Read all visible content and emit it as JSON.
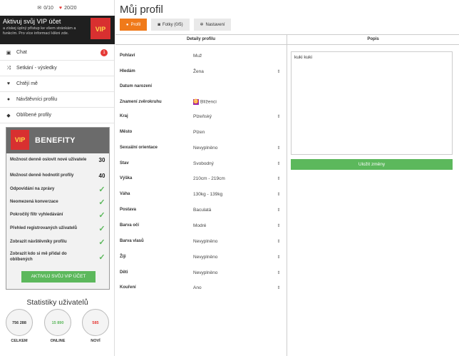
{
  "counters": {
    "messages": "0/10",
    "likes": "20/20"
  },
  "vip_banner": {
    "title": "Aktivuj svůj VIP účet",
    "subtitle": "a získej úplný přístup ke všem stránkám a funkcím. Pro více informací klikni zde.",
    "logo": "VIP"
  },
  "menu": [
    {
      "label": "Chat",
      "icon": "chat-icon",
      "glyph": "▣",
      "badge": "1"
    },
    {
      "label": "Setkání - výsledky",
      "icon": "shuffle-icon",
      "glyph": "⤨"
    },
    {
      "label": "Chtějí mě",
      "icon": "heart-icon",
      "glyph": "♥"
    },
    {
      "label": "Návštěvníci profilu",
      "icon": "user-icon",
      "glyph": "●"
    },
    {
      "label": "Oblíbené profily",
      "icon": "thumbs-up-icon",
      "glyph": "◆"
    }
  ],
  "benefits": {
    "logo": "VIP",
    "title": "BENEFITY",
    "rows": [
      {
        "label": "Možnost denně oslovit nové uživatele",
        "value": "30"
      },
      {
        "label": "Možnost denně hodnotit profily",
        "value": "40"
      },
      {
        "label": "Odpovídání na zprávy",
        "check": true
      },
      {
        "label": "Neomezená konverzace",
        "check": true
      },
      {
        "label": "Pokročilý filtr vyhledávání",
        "check": true
      },
      {
        "label": "Přehled registrovaných uživatelů",
        "check": true
      },
      {
        "label": "Zobrazit návštěvníky profilu",
        "check": true
      },
      {
        "label": "Zobrazit kdo si mě přidal do oblíbených",
        "check": true
      }
    ],
    "button": "AKTIVUJ SVŮJ VIP ÚČET"
  },
  "stats": {
    "title": "Statistiky uživatelů",
    "items": [
      {
        "value": "756 288",
        "label": "CELKEM",
        "color": "#333333"
      },
      {
        "value": "15 890",
        "label": "ONLINE",
        "color": "#5cb85c"
      },
      {
        "value": "585",
        "label": "NOVÍ",
        "color": "#e53935"
      }
    ]
  },
  "page_title": "Můj profil",
  "tabs": [
    {
      "label": "Profil",
      "icon": "user-icon",
      "active": true
    },
    {
      "label": "Fotky (0/5)",
      "icon": "camera-icon",
      "active": false
    },
    {
      "label": "Nastavení",
      "icon": "gear-icon",
      "active": false
    }
  ],
  "details": {
    "title": "Detaily profilu",
    "fields": [
      {
        "label": "Pohlaví",
        "value": "Muž"
      },
      {
        "label": "Hledám",
        "value": "Žena",
        "select": true
      },
      {
        "label": "Datum narození",
        "value": ""
      },
      {
        "label": "Znamení zvěrokruhu",
        "value": "Blíženci",
        "zodiac": "♊"
      },
      {
        "label": "Kraj",
        "value": "Plzeňský",
        "select": true
      },
      {
        "label": "Město",
        "value": "Plzen"
      },
      {
        "label": "Sexuální orientace",
        "value": "Nevyplněno",
        "select": true
      },
      {
        "label": "Stav",
        "value": "Svobodný",
        "select": true
      },
      {
        "label": "Výška",
        "value": "210cm - 219cm",
        "select": true
      },
      {
        "label": "Váha",
        "value": "130kg - 139kg",
        "select": true
      },
      {
        "label": "Postava",
        "value": "Baculatá",
        "select": true
      },
      {
        "label": "Barva očí",
        "value": "Modré",
        "select": true
      },
      {
        "label": "Barva vlasů",
        "value": "Nevyplněno",
        "select": true
      },
      {
        "label": "Žiji",
        "value": "Nevyplněno",
        "select": true
      },
      {
        "label": "Děti",
        "value": "Nevyplněno",
        "select": true
      },
      {
        "label": "Kouření",
        "value": "Ano",
        "select": true
      }
    ]
  },
  "popis": {
    "title": "Popis",
    "text": "kuki kuki",
    "save": "Uložit změny"
  },
  "colors": {
    "accent": "#f07a1a",
    "success": "#5cb85c",
    "danger": "#e53935"
  }
}
